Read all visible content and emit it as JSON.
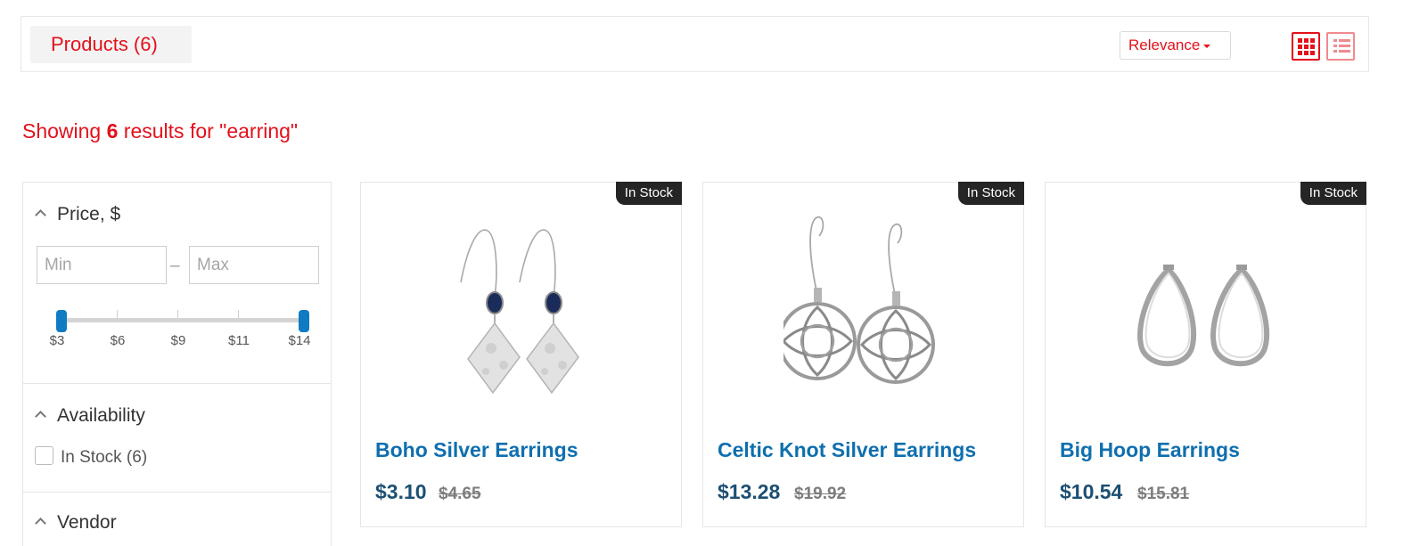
{
  "header": {
    "products_label": "Products (6)",
    "sort_label": "Relevance",
    "view_grid_icon": "grid-icon",
    "view_list_icon": "list-icon"
  },
  "results": {
    "prefix": "Showing ",
    "count": "6",
    "suffix": " results for \"earring\""
  },
  "filters": {
    "price": {
      "title": "Price, $",
      "min_placeholder": "Min",
      "max_placeholder": "Max",
      "separator": "–",
      "ticks": [
        "$3",
        "$6",
        "$9",
        "$11",
        "$14"
      ],
      "range_min": 3,
      "range_max": 14
    },
    "availability": {
      "title": "Availability",
      "option_label": "In Stock (6)"
    },
    "vendor": {
      "title": "Vendor"
    }
  },
  "products": [
    {
      "badge": "In Stock",
      "name": "Boho Silver Earrings",
      "price": "$3.10",
      "old_price": "$4.65"
    },
    {
      "badge": "In Stock",
      "name": "Celtic Knot Silver Earrings",
      "price": "$13.28",
      "old_price": "$19.92"
    },
    {
      "badge": "In Stock",
      "name": "Big Hoop Earrings",
      "price": "$10.54",
      "old_price": "$15.81"
    }
  ],
  "colors": {
    "accent": "#e3111b",
    "link": "#0f6fae",
    "price": "#1d4f73",
    "slider": "#0f7bc2"
  }
}
